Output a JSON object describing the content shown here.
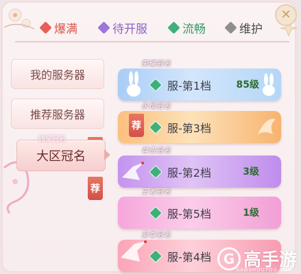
{
  "legend": [
    {
      "label": "爆满",
      "color": "#e5605a"
    },
    {
      "label": "待开服",
      "color": "#9c76d8"
    },
    {
      "label": "流畅",
      "color": "#3fb07a"
    },
    {
      "label": "维护",
      "color": "#8e8e8e"
    }
  ],
  "tabs": [
    {
      "label": "我的服务器"
    },
    {
      "label": "推荐服务器",
      "badge": "荐"
    },
    {
      "label": "大区冠名",
      "subtitle": "独家冠名",
      "badge": "荐",
      "selected": true
    }
  ],
  "servers": [
    {
      "title": "荣耀冠名",
      "name": "服-第1档",
      "level": "85级",
      "status_color": "#3fb07a"
    },
    {
      "title": "永恒冠名",
      "name": "服-第3档",
      "level": "",
      "badge": "荐",
      "status_color": "#3fb07a"
    },
    {
      "title": "尊贵冠名",
      "name": "服-第2档",
      "level": "3级",
      "status_color": "#3fb07a"
    },
    {
      "title": "王者冠名",
      "name": "服-第5档",
      "level": "1级",
      "status_color": "#3fb07a"
    },
    {
      "title": "至尊冠名",
      "name": "服-第4档",
      "level": "",
      "status_color": "#3fb07a"
    }
  ],
  "watermark": {
    "logo": "G",
    "text": "高手游",
    "sub": "GAOSHOUYOU.COM"
  }
}
